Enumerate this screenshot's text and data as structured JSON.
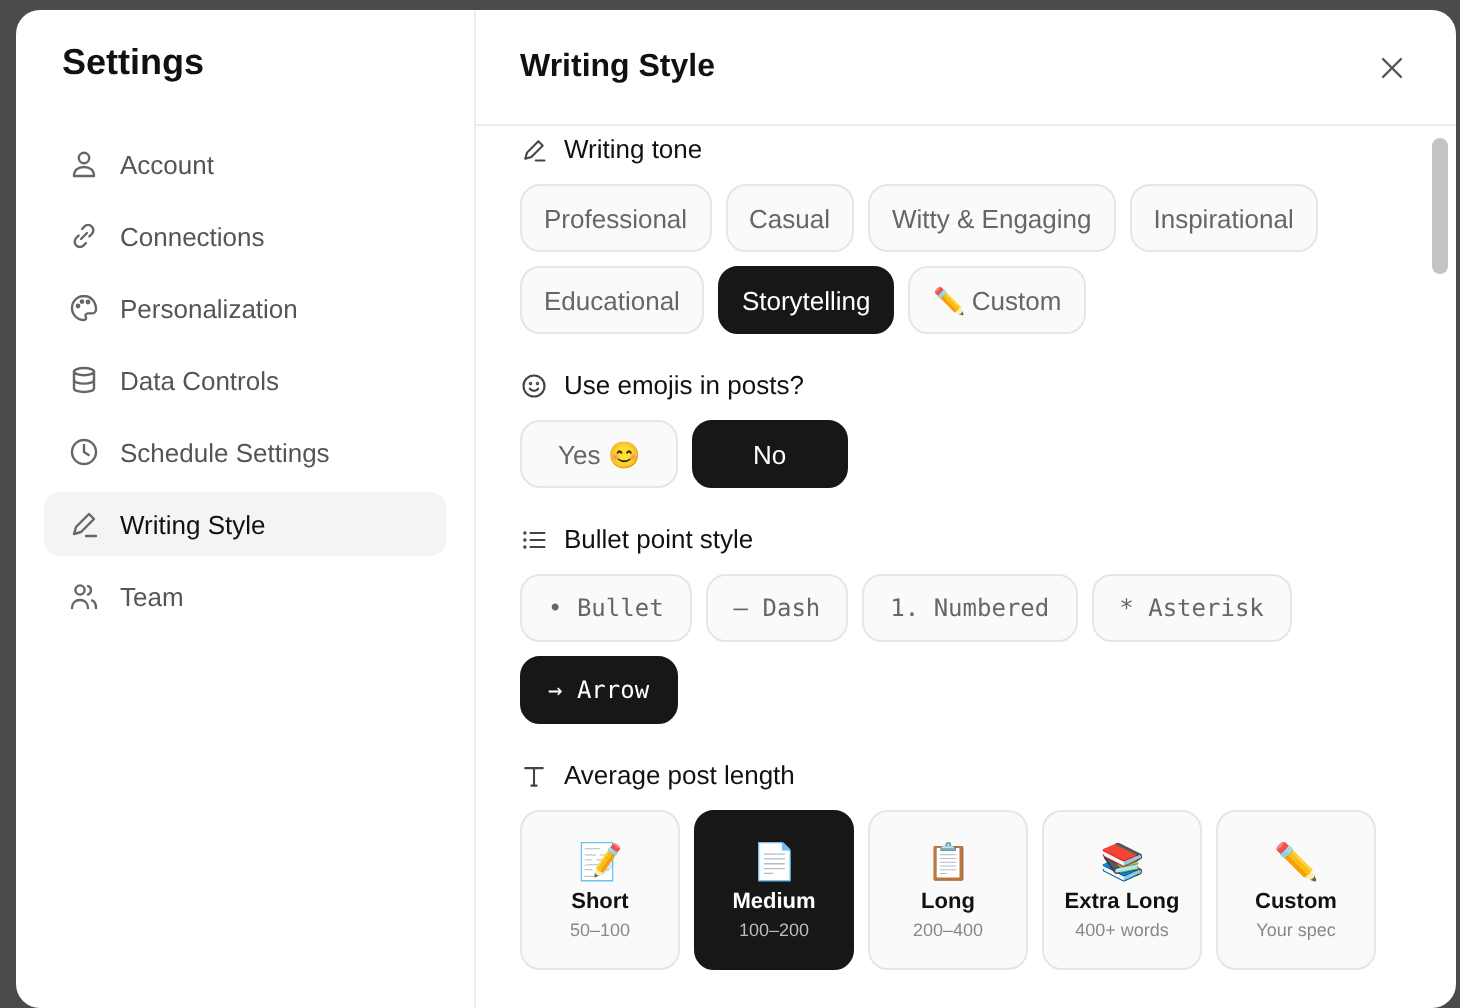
{
  "window": {
    "title": "Settings"
  },
  "sidebar": {
    "items": [
      {
        "label": "Account",
        "selected": false
      },
      {
        "label": "Connections",
        "selected": false
      },
      {
        "label": "Personalization",
        "selected": false
      },
      {
        "label": "Data Controls",
        "selected": false
      },
      {
        "label": "Schedule Settings",
        "selected": false
      },
      {
        "label": "Writing Style",
        "selected": true
      },
      {
        "label": "Team",
        "selected": false
      }
    ]
  },
  "panel": {
    "title": "Writing Style"
  },
  "sections": [
    {
      "kind": "chips",
      "title": "Writing tone",
      "options": [
        {
          "label": "Professional",
          "selected": false
        },
        {
          "label": "Casual",
          "selected": false
        },
        {
          "label": "Witty & Engaging",
          "selected": false
        },
        {
          "label": "Inspirational",
          "selected": false
        },
        {
          "label": "Educational",
          "selected": false
        },
        {
          "label": "Storytelling",
          "selected": true
        },
        {
          "label": "✏️ Custom",
          "selected": false
        }
      ]
    },
    {
      "kind": "chips",
      "title": "Use emojis in posts?",
      "options": [
        {
          "label": "Yes 😊",
          "selected": false
        },
        {
          "label": "No",
          "selected": true
        }
      ]
    },
    {
      "kind": "mono-chips",
      "title": "Bullet point style",
      "options": [
        {
          "label": "• Bullet",
          "selected": false
        },
        {
          "label": "– Dash",
          "selected": false
        },
        {
          "label": "1. Numbered",
          "selected": false
        },
        {
          "label": "* Asterisk",
          "selected": false
        },
        {
          "label": "→ Arrow",
          "selected": true
        }
      ]
    },
    {
      "kind": "cards",
      "title": "Average post length",
      "options": [
        {
          "emoji": "📝",
          "label": "Short",
          "detail": "50–100",
          "selected": false
        },
        {
          "emoji": "📄",
          "label": "Medium",
          "detail": "100–200",
          "selected": true
        },
        {
          "emoji": "📋",
          "label": "Long",
          "detail": "200–400",
          "selected": false
        },
        {
          "emoji": "📚",
          "label": "Extra Long",
          "detail": "400+ words",
          "selected": false
        },
        {
          "emoji": "✏️",
          "label": "Custom",
          "detail": "Your spec",
          "selected": false
        }
      ]
    }
  ]
}
